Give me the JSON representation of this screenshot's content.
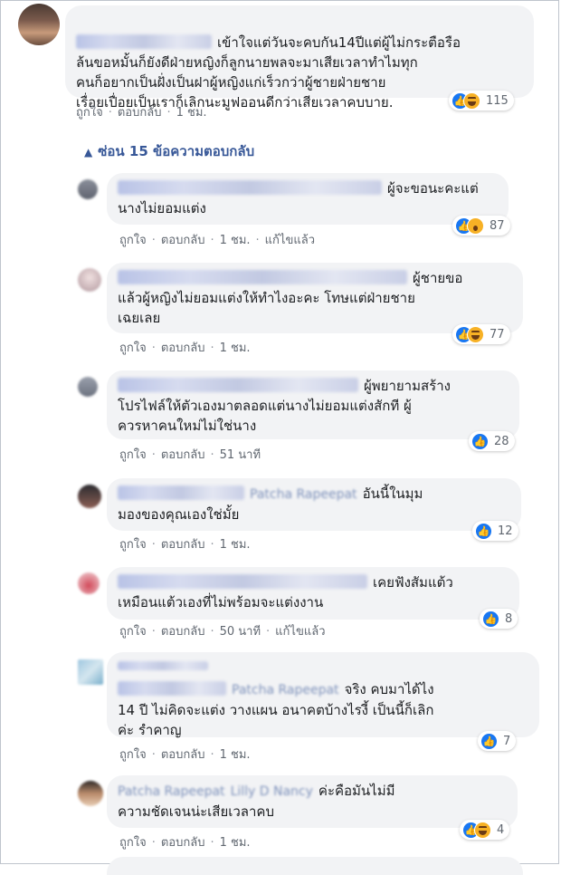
{
  "comments": [
    {
      "text": "เข้าใจแต่วันจะคบกัน14ปีแต่ผู้ไม่กระตือรือ\nล้นขอหมั้นก็ยังดีฝ่ายหญิงก็ลูกนายพลจะมาเสียเวลาทำไมทุก\nคนก็อยากเป็นฝั่งเป็นฝาผู้หญิงแก่เร็วกว่าผู้ชายฝ่ายชาย\nเรื่อยเปื่อยเป็นเราก็เลิกนะมูฟออนดีกว่าเสียเวลาคบบาย.",
      "like": "ถูกใจ",
      "reply": "ตอบกลับ",
      "time": "1 ชม.",
      "edited": "",
      "reactions": [
        "like",
        "haha"
      ],
      "count": "115"
    },
    {
      "text": "ผู้จะขอนะคะแต่\nนางไม่ยอมแต่ง",
      "like": "ถูกใจ",
      "reply": "ตอบกลับ",
      "time": "1 ชม.",
      "edited": "แก้ไขแล้ว",
      "reactions": [
        "like",
        "wow"
      ],
      "count": "87"
    },
    {
      "text": "ผู้ชายขอ\nแล้วผู้หญิงไม่ยอมแต่งให้ทำไงอะคะ โทษแต่ฝ่ายชาย\nเฉยเลย",
      "like": "ถูกใจ",
      "reply": "ตอบกลับ",
      "time": "1 ชม.",
      "edited": "",
      "reactions": [
        "like",
        "haha"
      ],
      "count": "77"
    },
    {
      "text": "ผู้พยายามสร้าง\nโปรไฟล์ให้ตัวเองมาตลอดแต่นางไม่ยอมแต่งสักที ผู้\nควรหาคนใหม่ไม่ใช่นาง",
      "like": "ถูกใจ",
      "reply": "ตอบกลับ",
      "time": "51 นาที",
      "edited": "",
      "reactions": [
        "like"
      ],
      "count": "28"
    },
    {
      "text": "อันนี้ในมุม\nมองของคุณเองใช่มั้ย",
      "mention": "Patcha Rapeepat",
      "like": "ถูกใจ",
      "reply": "ตอบกลับ",
      "time": "1 ชม.",
      "edited": "",
      "reactions": [
        "like"
      ],
      "count": "12"
    },
    {
      "text": "เคยฟังสัมแต้ว\nเหมือนแต้วเองที่ไม่พร้อมจะแต่งงาน",
      "like": "ถูกใจ",
      "reply": "ตอบกลับ",
      "time": "50 นาที",
      "edited": "แก้ไขแล้ว",
      "reactions": [
        "like"
      ],
      "count": "8"
    },
    {
      "text": "จริง คบมาได้ไง\n14 ปี ไม่คิดจะแต่ง วางแผน อนาคตบ้างไรงี้ เป็นนี้ก็เลิก\nค่ะ รำคาญ",
      "mention": "Patcha Rapeepat",
      "like": "ถูกใจ",
      "reply": "ตอบกลับ",
      "time": "1 ชม.",
      "edited": "",
      "reactions": [
        "like"
      ],
      "count": "7"
    },
    {
      "text": "ค่ะคือมันไม่มี\nความชัดเจนน่ะเสียเวลาคบ",
      "mention": "Patcha Rapeepat",
      "mention2": "Lilly D Nancy",
      "like": "ถูกใจ",
      "reply": "ตอบกลับ",
      "time": "1 ชม.",
      "edited": "",
      "reactions": [
        "like",
        "haha"
      ],
      "count": "4"
    }
  ],
  "hide_replies": "ซ่อน 15 ข้อความตอบกลับ"
}
